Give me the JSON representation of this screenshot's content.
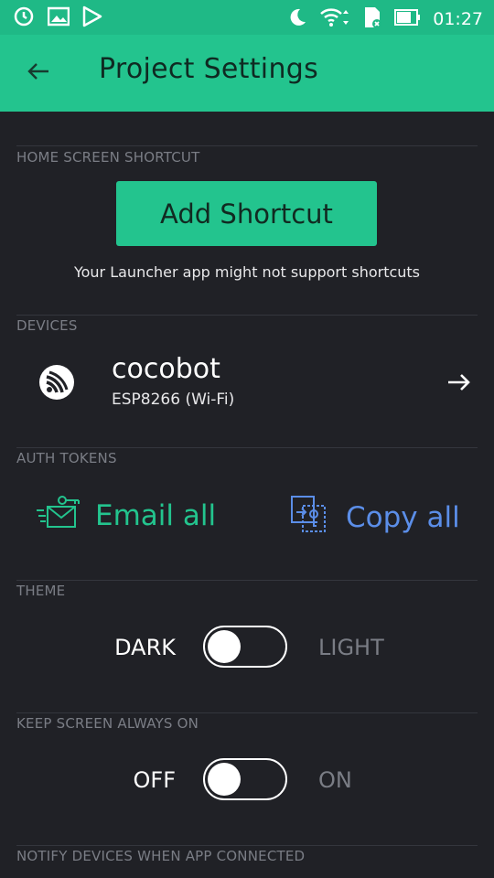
{
  "status_bar": {
    "time": "01:27",
    "left_icons": [
      "sync-icon",
      "image-icon",
      "play-store-icon"
    ],
    "right_icons": [
      "moon-icon",
      "wifi-icon",
      "sd-card-icon",
      "battery-icon"
    ]
  },
  "header": {
    "title": "Project Settings",
    "back_icon": "arrow-left-icon"
  },
  "sections": {
    "home_shortcut": {
      "label": "HOME SCREEN SHORTCUT",
      "button_label": "Add Shortcut",
      "note": "Your Launcher app might not support shortcuts"
    },
    "devices": {
      "label": "DEVICES",
      "items": [
        {
          "name": "cocobot",
          "type": "ESP8266 (Wi-Fi)",
          "icon": "espressif-icon"
        }
      ]
    },
    "auth_tokens": {
      "label": "AUTH TOKENS",
      "email_all": "Email all",
      "copy_all": "Copy all"
    },
    "theme": {
      "label": "THEME",
      "left": "DARK",
      "right": "LIGHT",
      "value": "DARK"
    },
    "keep_screen_on": {
      "label": "KEEP SCREEN ALWAYS ON",
      "left": "OFF",
      "right": "ON",
      "value": "OFF"
    },
    "notify_devices": {
      "label": "NOTIFY DEVICES WHEN APP CONNECTED"
    }
  },
  "colors": {
    "accent": "#23c48e",
    "status_bar": "#1fb986",
    "background": "#202126",
    "link_blue": "#5b8ee8",
    "muted": "#7a7d85"
  }
}
